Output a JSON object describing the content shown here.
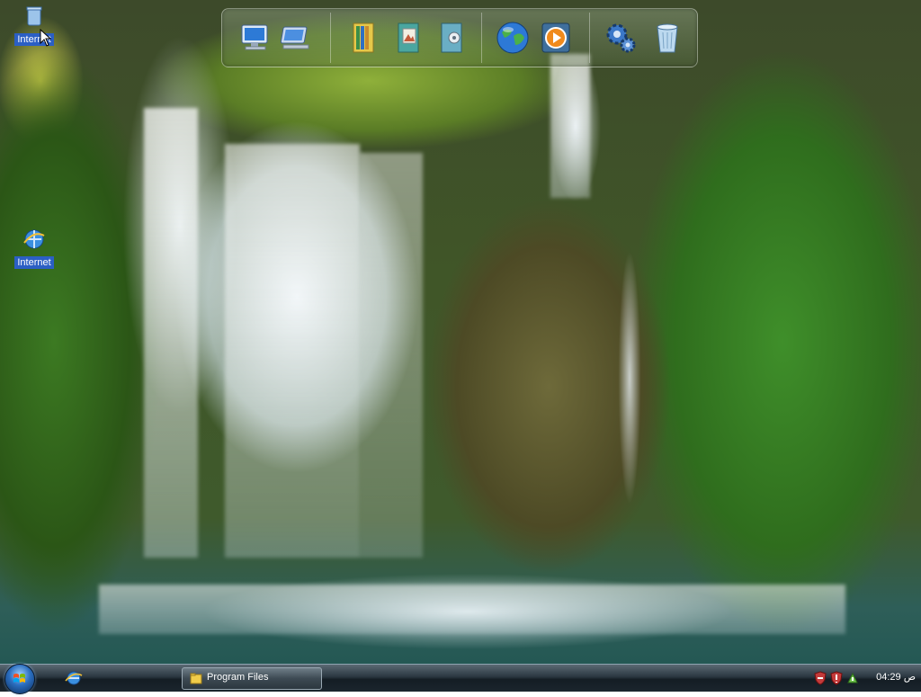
{
  "desktop": {
    "icons": [
      {
        "label": "Internet"
      },
      {
        "label": "Internet"
      }
    ]
  },
  "dock": {
    "items": [
      {
        "icon": "my-computer-icon"
      },
      {
        "icon": "network-places-icon"
      },
      {
        "icon": "documents-folder-icon"
      },
      {
        "icon": "pictures-folder-icon"
      },
      {
        "icon": "music-folder-icon"
      },
      {
        "icon": "internet-globe-icon"
      },
      {
        "icon": "media-player-icon"
      },
      {
        "icon": "settings-gears-icon"
      },
      {
        "icon": "recycle-bin-icon"
      }
    ]
  },
  "taskbar": {
    "task_label": "Program Files",
    "clock": "04:29 ص"
  },
  "colors": {
    "taskbar": "#1b252d",
    "icon_label_bg": "#2b5fc4"
  }
}
